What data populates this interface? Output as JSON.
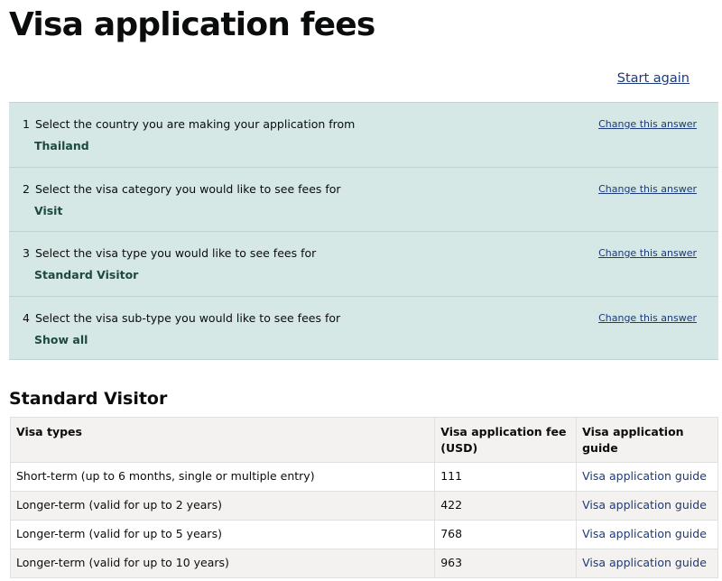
{
  "header": {
    "title": "Visa application fees",
    "start_again": "Start again"
  },
  "answers": [
    {
      "number": "1",
      "question": "Select the country you are making your application from",
      "answer": "Thailand",
      "change": "Change this answer"
    },
    {
      "number": "2",
      "question": "Select the visa category you would like to see fees for",
      "answer": "Visit",
      "change": "Change this answer"
    },
    {
      "number": "3",
      "question": "Select the visa type you would like to see fees for",
      "answer": "Standard Visitor",
      "change": "Change this answer"
    },
    {
      "number": "4",
      "question": "Select the visa sub-type you would like to see fees for",
      "answer": "Show all",
      "change": "Change this answer"
    }
  ],
  "results": {
    "heading": "Standard Visitor",
    "columns": [
      "Visa types",
      "Visa application fee (USD)",
      "Visa application guide"
    ],
    "rows": [
      {
        "type": "Short-term (up to 6 months, single or multiple entry)",
        "fee": "111",
        "guide": "Visa application guide"
      },
      {
        "type": "Longer-term (valid for up to 2 years)",
        "fee": "422",
        "guide": "Visa application guide"
      },
      {
        "type": "Longer-term (valid for up to 5 years)",
        "fee": "768",
        "guide": "Visa application guide"
      },
      {
        "type": "Longer-term (valid for up to 10 years)",
        "fee": "963",
        "guide": "Visa application guide"
      }
    ]
  },
  "colors": {
    "panel_background": "#d5e8e5",
    "link": "#1d3a78",
    "answer_text": "#1e4a3e",
    "table_header_background": "#f3f2f1"
  }
}
